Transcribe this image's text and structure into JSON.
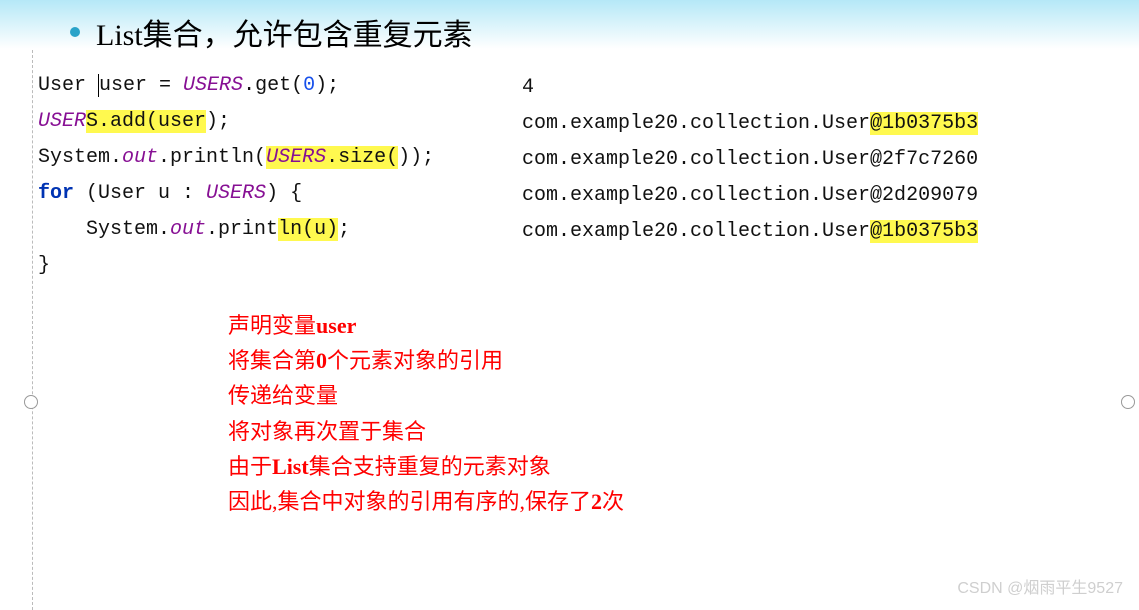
{
  "bullet": {
    "text": "List集合，允许包含重复元素"
  },
  "code": {
    "l1a": "User ",
    "l1b": "u",
    "l1c": "ser = ",
    "l1d": "USERS",
    "l1e": ".get(",
    "l1f": "0",
    "l1g": ");",
    "l2a": "USER",
    "l2b": "S.add(user",
    "l2c": ");",
    "l3a": "System.",
    "l3b": "out",
    "l3c": ".println(",
    "l3d": "USERS",
    "l3e": ".size(",
    "l3f": "));",
    "l4a": "for",
    "l4b": " (User u : ",
    "l4c": "USERS",
    "l4d": ") {",
    "l5a": "    System.",
    "l5b": "out",
    "l5c": ".print",
    "l5d": "ln(u)",
    "l5e": ";",
    "l6": "}"
  },
  "output": {
    "l1": "4",
    "l2a": "com.example20.collection.User",
    "l2b": "@1b0375b3",
    "l3": "com.example20.collection.User@2f7c7260",
    "l4": "com.example20.collection.User@2d209079",
    "l5a": "com.example20.collection.User",
    "l5b": "@1b0375b3"
  },
  "explain": {
    "l1a": "声明变量",
    "l1b": "user",
    "l2a": "将集合第",
    "l2b": "0",
    "l2c": "个元素对象的引用",
    "l3": "传递给变量",
    "l4": "将对象再次置于集合",
    "l5a": "由于",
    "l5b": "List",
    "l5c": "集合支持重复的元素对象",
    "l6a": "因此,集合中对象的引用有序的,保存了",
    "l6b": "2",
    "l6c": "次"
  },
  "watermark": "CSDN @烟雨平生9527"
}
